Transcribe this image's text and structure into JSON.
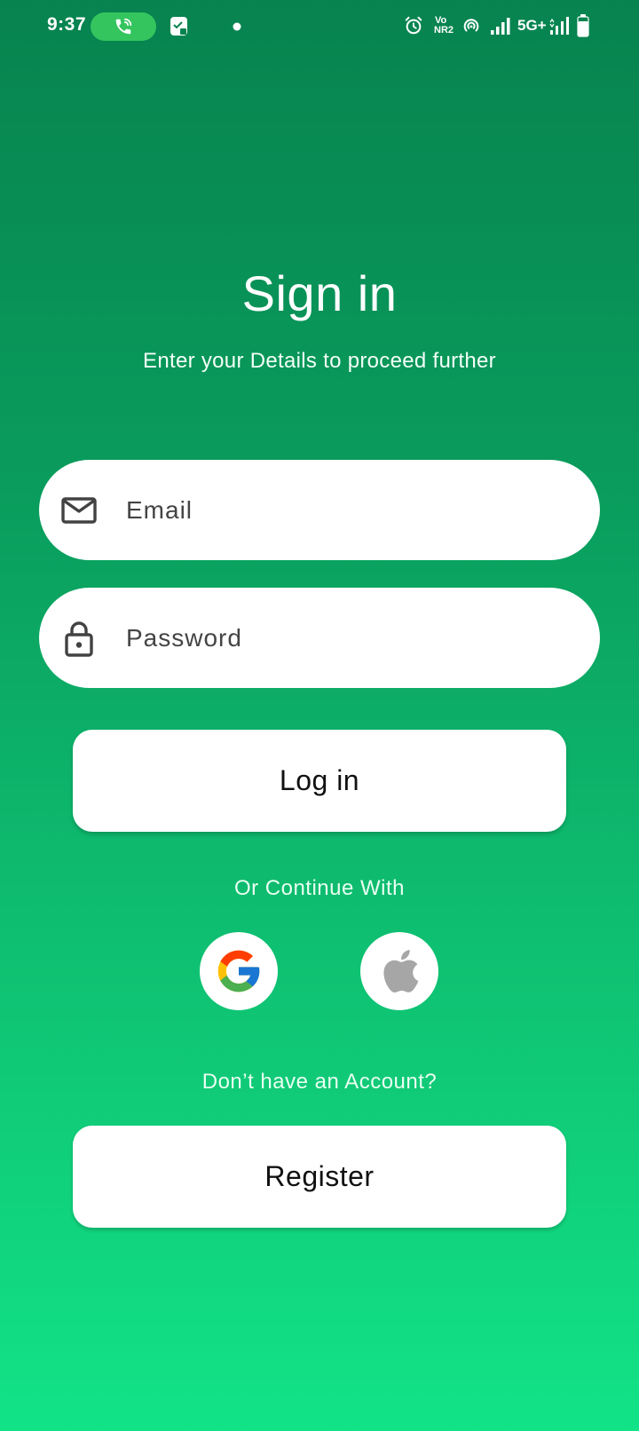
{
  "status_bar": {
    "time": "9:37",
    "network": "5G+",
    "volte": "Vo",
    "nr": "NR2"
  },
  "header": {
    "title": "Sign in",
    "subtitle": "Enter your Details to proceed further"
  },
  "form": {
    "email_placeholder": "Email",
    "password_placeholder": "Password",
    "login_label": "Log in"
  },
  "social": {
    "heading": "Or Continue With"
  },
  "register": {
    "prompt": "Don’t have an Account?",
    "button_label": "Register"
  },
  "colors": {
    "gradient_top": "#07834f",
    "gradient_bottom": "#12e387",
    "call_pill": "#35c55f"
  }
}
